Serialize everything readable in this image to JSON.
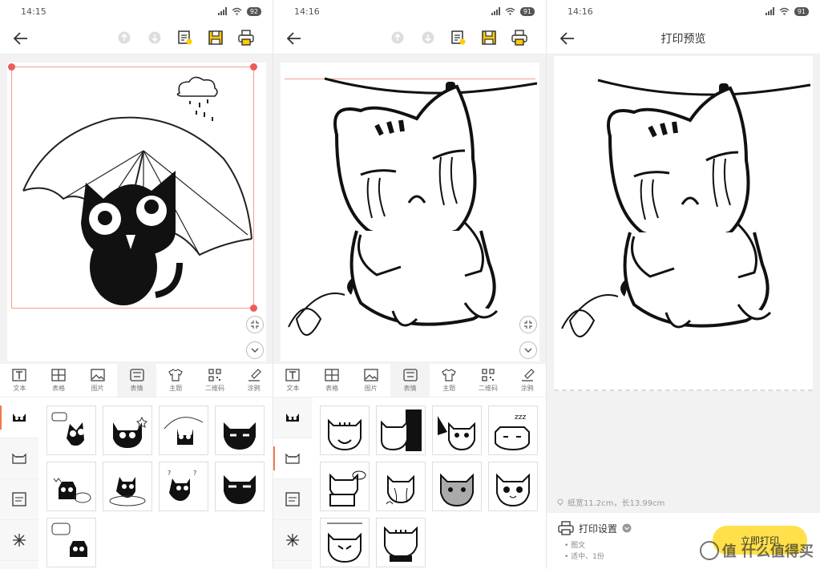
{
  "screens": [
    {
      "time": "14:15",
      "battery": "92",
      "tabs": [
        "文本",
        "表格",
        "图片",
        "表情",
        "主题",
        "二维码",
        "涂鸦"
      ],
      "active_tab": 3
    },
    {
      "time": "14:16",
      "battery": "91",
      "tabs": [
        "文本",
        "表格",
        "图片",
        "表情",
        "主题",
        "二维码",
        "涂鸦"
      ],
      "active_tab": 3
    },
    {
      "time": "14:16",
      "battery": "91",
      "title": "打印预览",
      "paper_info": "纸宽11.2cm，长13.99cm",
      "print_settings_label": "打印设置",
      "print_settings_items": [
        "图文",
        "适中、1份"
      ],
      "print_button": "立即打印",
      "watermark": "值 什么值得买"
    }
  ],
  "colors": {
    "accent": "#ffe04a",
    "selection": "#f0a08a",
    "handle": "#ef5a5a",
    "active_indicator": "#f07a4a"
  },
  "icons": {
    "back": "arrow-left-icon",
    "undo": "undo-icon",
    "redo": "redo-icon",
    "template": "template-icon",
    "save": "save-icon",
    "print": "printer-icon"
  }
}
